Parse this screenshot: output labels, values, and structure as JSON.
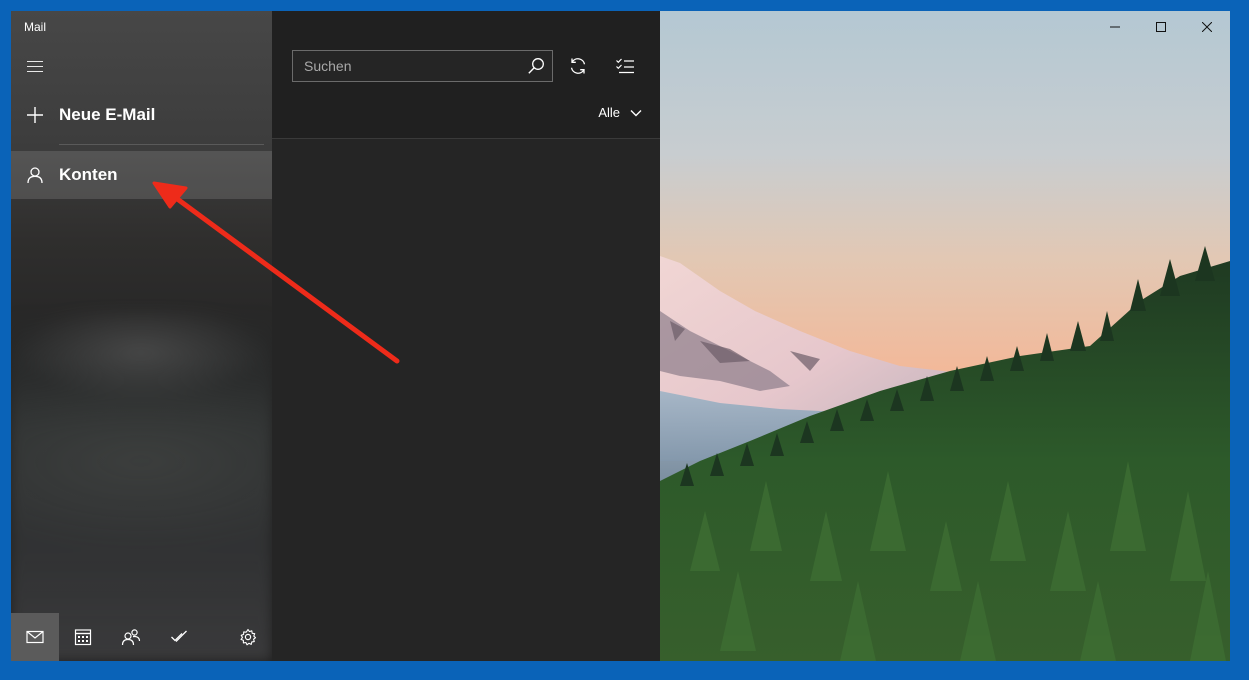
{
  "app": {
    "title": "Mail"
  },
  "nav": {
    "new_mail_label": "Neue E-Mail",
    "accounts_label": "Konten"
  },
  "bottom_bar": {
    "items": [
      "mail-icon",
      "calendar-icon",
      "people-icon",
      "todo-icon",
      "settings-icon"
    ],
    "active": "mail-icon"
  },
  "list": {
    "search_placeholder": "Suchen",
    "filter_label": "Alle"
  },
  "window_controls": [
    "minimize-icon",
    "maximize-icon",
    "close-icon"
  ],
  "colors": {
    "desktop": "#0a63b8",
    "annotation_arrow": "#ee2b1a"
  }
}
